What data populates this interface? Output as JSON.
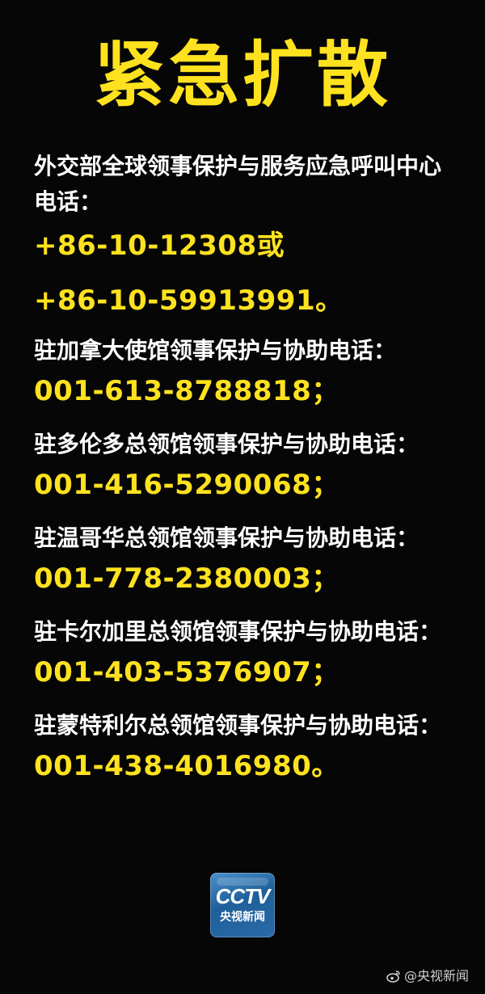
{
  "title": "紧急扩散",
  "intro": {
    "label_line1": "外交部全球领事保护与服务应急呼叫中心",
    "label_line2": "电话：",
    "phone_line1": "+86-10-12308或",
    "phone_line2": "+86-10-59913991。"
  },
  "contacts": [
    {
      "label": "驻加拿大使馆领事保护与协助电话：",
      "phone": "001-613-8788818；"
    },
    {
      "label": "驻多伦多总领馆领事保护与协助电话：",
      "phone": "001-416-5290068；"
    },
    {
      "label": "驻温哥华总领馆领事保护与协助电话：",
      "phone": "001-778-2380003；"
    },
    {
      "label": "驻卡尔加里总领馆领事保护与协助电话：",
      "phone": "001-403-5376907；"
    },
    {
      "label": "驻蒙特利尔总领馆领事保护与协助电话：",
      "phone": "001-438-4016980。"
    }
  ],
  "logo": {
    "mark": "CCTV",
    "text": "央视新闻"
  },
  "watermark": {
    "icon": "weibo-icon",
    "text": "@央视新闻"
  },
  "colors": {
    "background": "#060606",
    "accent": "#ffe21f",
    "label": "#ffffff"
  }
}
